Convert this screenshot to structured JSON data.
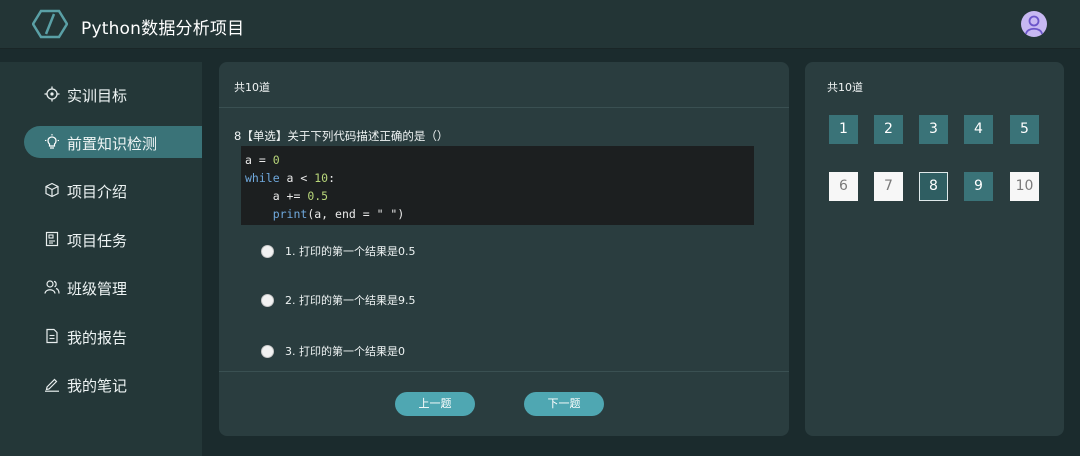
{
  "header": {
    "app_title": "Python数据分析项目",
    "logo_icon": "logo-icon",
    "avatar_icon": "user-avatar-icon",
    "accent_color": "#3a7378"
  },
  "sidebar": {
    "items": [
      {
        "label": "实训目标",
        "icon": "target-icon",
        "active": false
      },
      {
        "label": "前置知识检测",
        "icon": "lightbulb-icon",
        "active": true
      },
      {
        "label": "项目介绍",
        "icon": "cube-icon",
        "active": false
      },
      {
        "label": "项目任务",
        "icon": "task-list-icon",
        "active": false
      },
      {
        "label": "班级管理",
        "icon": "people-icon",
        "active": false
      },
      {
        "label": "我的报告",
        "icon": "document-icon",
        "active": false
      },
      {
        "label": "我的笔记",
        "icon": "pen-icon",
        "active": false
      }
    ]
  },
  "question": {
    "total_label": "共10道",
    "title": "8【单选】关于下列代码描述正确的是（）",
    "code_lines": [
      "a = 0",
      "while a < 10:",
      "    a += 0.5",
      "    print(a, end = \" \")"
    ],
    "options": [
      "1. 打印的第一个结果是0.5",
      "2. 打印的第一个结果是9.5",
      "3. 打印的第一个结果是0"
    ],
    "prev_label": "上一题",
    "next_label": "下一题"
  },
  "answer_sheet": {
    "total_label": "共10道",
    "numbers": [
      {
        "label": "1",
        "state": "done"
      },
      {
        "label": "2",
        "state": "done"
      },
      {
        "label": "3",
        "state": "done"
      },
      {
        "label": "4",
        "state": "done"
      },
      {
        "label": "5",
        "state": "done"
      },
      {
        "label": "6",
        "state": "todo"
      },
      {
        "label": "7",
        "state": "todo"
      },
      {
        "label": "8",
        "state": "current"
      },
      {
        "label": "9",
        "state": "done"
      },
      {
        "label": "10",
        "state": "todo"
      }
    ]
  }
}
